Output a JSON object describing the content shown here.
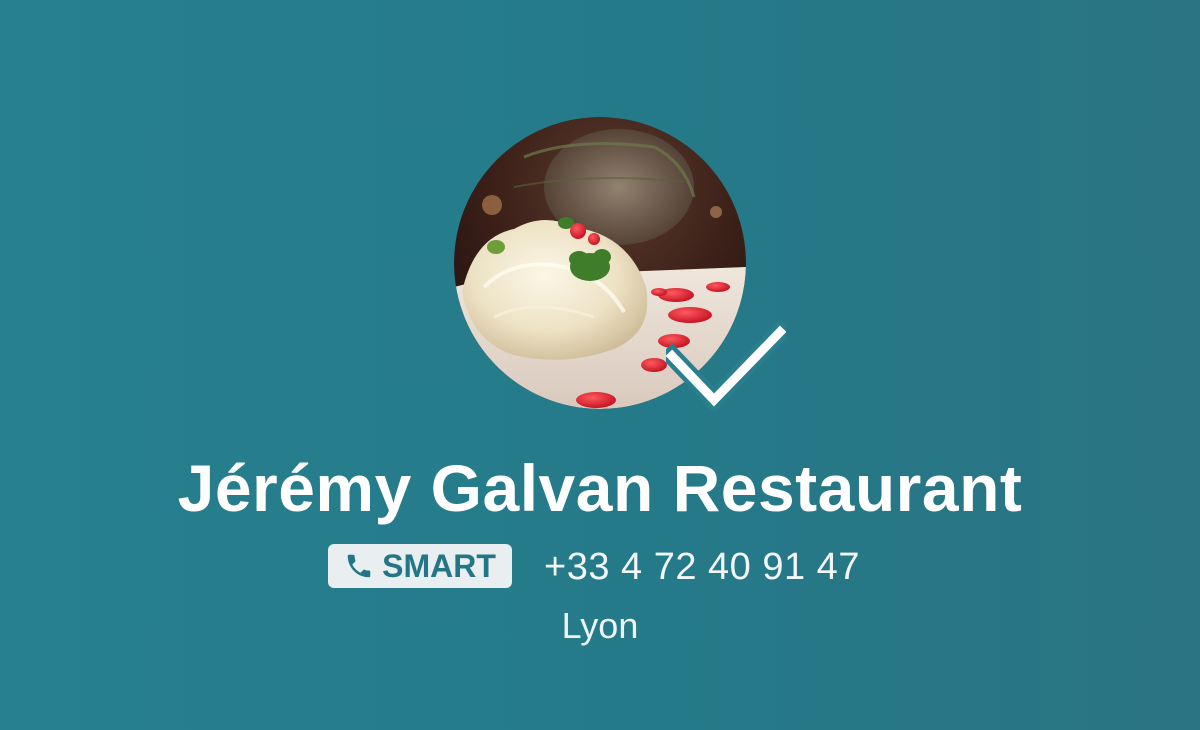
{
  "profile": {
    "name": "Jérémy Galvan Restaurant",
    "avatar_description": "plated dish photo",
    "verified_icon": "checkmark-icon"
  },
  "contact": {
    "badge_icon": "phone-icon",
    "badge_label": "SMART",
    "phone": "+33 4 72 40 91 47",
    "location": "Lyon"
  },
  "colors": {
    "background": "#26808f",
    "badge_background": "#e9eef0",
    "badge_text": "#237686",
    "text": "#ffffff"
  }
}
